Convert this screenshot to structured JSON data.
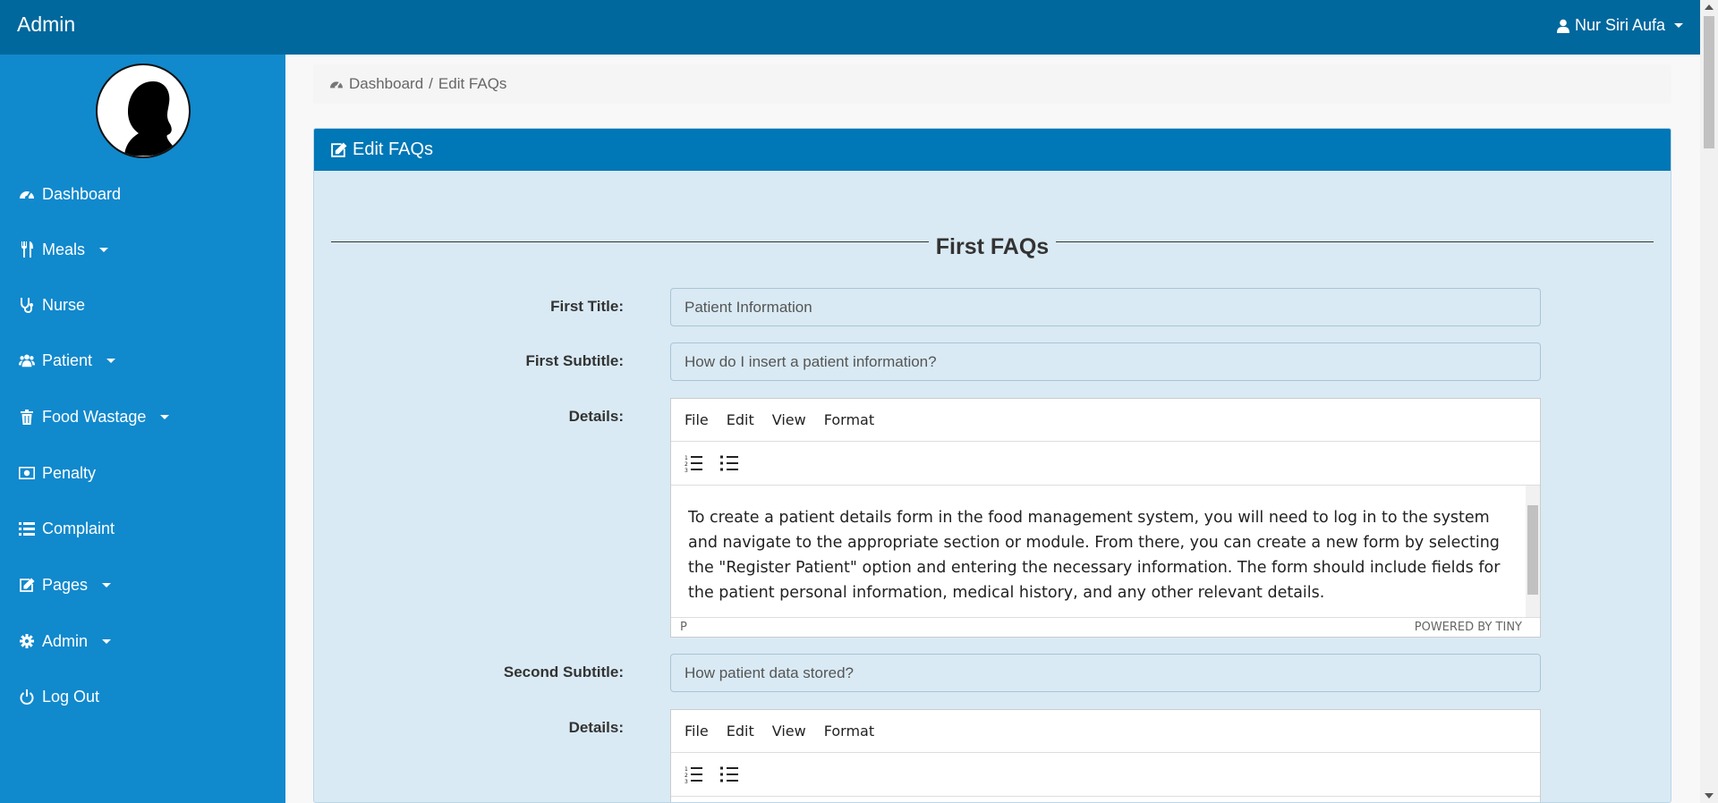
{
  "topbar": {
    "brand": "Admin",
    "user_name": "Nur Siri Aufa"
  },
  "sidebar": {
    "items": [
      {
        "label": "Dashboard",
        "icon": "dashboard-icon",
        "has_caret": false
      },
      {
        "label": "Meals",
        "icon": "utensils-icon",
        "has_caret": true
      },
      {
        "label": "Nurse",
        "icon": "stethoscope-icon",
        "has_caret": false
      },
      {
        "label": "Patient",
        "icon": "users-icon",
        "has_caret": true
      },
      {
        "label": "Food Wastage",
        "icon": "trash-icon",
        "has_caret": true
      },
      {
        "label": "Penalty",
        "icon": "money-icon",
        "has_caret": false
      },
      {
        "label": "Complaint",
        "icon": "list-icon",
        "has_caret": false
      },
      {
        "label": "Pages",
        "icon": "edit-icon",
        "has_caret": true
      },
      {
        "label": "Admin",
        "icon": "gear-icon",
        "has_caret": true
      },
      {
        "label": "Log Out",
        "icon": "power-icon",
        "has_caret": false
      }
    ]
  },
  "breadcrumb": {
    "home": "Dashboard",
    "separator": "/",
    "current": "Edit FAQs"
  },
  "panel": {
    "title": "Edit FAQs",
    "section_title": "First FAQs",
    "first_title_label": "First Title:",
    "first_title_value": "Patient Information",
    "first_subtitle_label": "First Subtitle:",
    "first_subtitle_value": "How do I insert a patient information?",
    "details_label": "Details:",
    "editor1": {
      "menu": [
        "File",
        "Edit",
        "View",
        "Format"
      ],
      "content": "To create a patient details form in the food management system, you will need to log in to the system and navigate to the appropriate section or module. From there, you can create a new form by selecting the \"Register Patient\" option and entering the necessary information. The form should include fields for the patient personal information, medical history, and any other relevant details.",
      "status_path": "P",
      "powered_by": "POWERED BY TINY"
    },
    "second_subtitle_label": "Second Subtitle:",
    "second_subtitle_value": "How patient data stored?",
    "details2_label": "Details:",
    "editor2": {
      "menu": [
        "File",
        "Edit",
        "View",
        "Format"
      ]
    }
  },
  "colors": {
    "topbar": "#00689d",
    "sidebar": "#1189cd",
    "panel_header": "#0077b6",
    "panel_body": "#d9eaf4"
  }
}
